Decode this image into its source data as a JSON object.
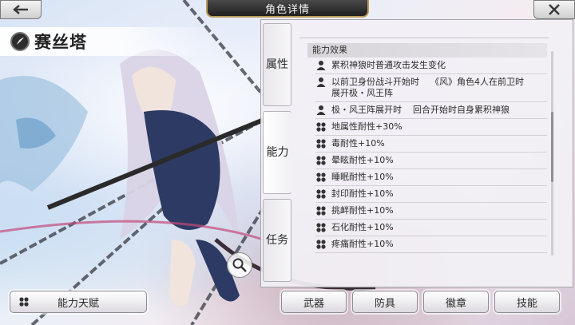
{
  "header": {
    "title": "角色详情",
    "back_icon": "back-arrow-icon",
    "close_icon": "close-x-icon"
  },
  "character": {
    "name": "赛丝塔",
    "element_icon": "wind-element-icon"
  },
  "tabs": [
    {
      "label": "属性",
      "active": false
    },
    {
      "label": "能力",
      "active": true
    },
    {
      "label": "任务",
      "active": false
    }
  ],
  "ability": {
    "section_title": "能力效果",
    "rows": [
      {
        "icon": "person-icon",
        "text": "累积神狼时普通攻击发生变化"
      },
      {
        "icon": "person-icon",
        "text": "以前卫身份战斗开始时    《风》角色4人在前卫时\n展开极・风王阵"
      },
      {
        "icon": "person-icon",
        "text": "极・风王阵展开时    回合开始时自身累积神狼"
      },
      {
        "icon": "party-icon",
        "text": "地属性耐性+30%"
      },
      {
        "icon": "party-icon",
        "text": "毒耐性+10%"
      },
      {
        "icon": "party-icon",
        "text": "晕眩耐性+10%"
      },
      {
        "icon": "party-icon",
        "text": "睡眠耐性+10%"
      },
      {
        "icon": "party-icon",
        "text": "封印耐性+10%"
      },
      {
        "icon": "party-icon",
        "text": "挑衅耐性+10%"
      },
      {
        "icon": "party-icon",
        "text": "石化耐性+10%"
      },
      {
        "icon": "party-icon",
        "text": "疼痛耐性+10%"
      }
    ]
  },
  "buttons": {
    "talent": "能力天赋",
    "weapon": "武器",
    "armor": "防具",
    "badge": "徽章",
    "skill": "技能"
  },
  "colors": {
    "title_bar": "#2b2b2b",
    "title_border": "#b89a5a",
    "panel_bg": "#f2f0f5"
  }
}
